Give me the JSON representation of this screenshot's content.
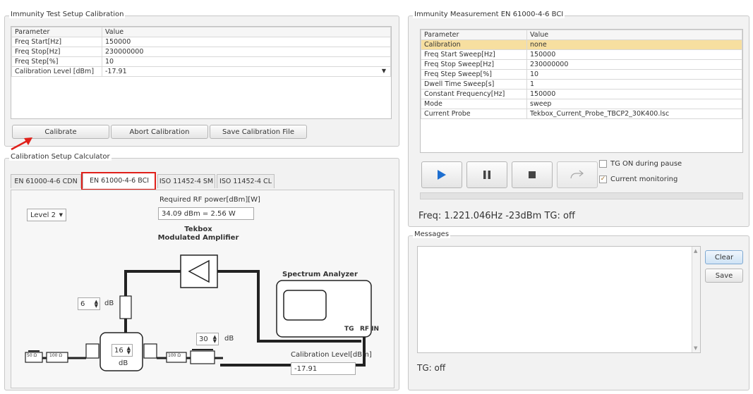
{
  "calibration_group": {
    "title": "Immunity Test Setup Calibration",
    "headers": [
      "Parameter",
      "Value"
    ],
    "rows": [
      [
        "Freq Start[Hz]",
        "150000"
      ],
      [
        "Freq Stop[Hz]",
        "230000000"
      ],
      [
        "Freq Step[%]",
        "10"
      ],
      [
        "Calibration Level [dBm]",
        "-17.91"
      ]
    ],
    "buttons": {
      "calibrate": "Calibrate",
      "abort": "Abort Calibration",
      "save": "Save Calibration File"
    }
  },
  "calculator_group": {
    "title": "Calibration Setup Calculator",
    "tabs": [
      "EN 61000-4-6 CDN",
      "EN 61000-4-6 BCI",
      "ISO 11452-4 SM",
      "ISO 11452-4 CL"
    ],
    "active_tab_index": 1,
    "level_select": "Level 2",
    "required_rf_label": "Required RF power[dBm][W]",
    "required_rf_value": "34.09 dBm = 2.56 W",
    "amplifier_label_1": "Tekbox",
    "amplifier_label_2": "Modulated Amplifier",
    "spectrum_analyzer_label": "Spectrum Analyzer",
    "tg_label": "TG",
    "rfin_label": "RF IN",
    "attenuator_1_value": "6",
    "attenuator_2_value": "30",
    "attenuator_3_value": "16",
    "db_unit": "dB",
    "load_label": "50 Ω",
    "resistor_label": "100 Ω",
    "cal_level_label": "Calibration Level[dBm]",
    "cal_level_value": "-17.91"
  },
  "measurement_group": {
    "title": "Immunity Measurement EN 61000-4-6 BCI",
    "headers": [
      "Parameter",
      "Value"
    ],
    "rows": [
      [
        "Calibration",
        "none"
      ],
      [
        "Freq Start Sweep[Hz]",
        "150000"
      ],
      [
        "Freq Stop Sweep[Hz]",
        "230000000"
      ],
      [
        "Freq Step Sweep[%]",
        "10"
      ],
      [
        "Dwell Time Sweep[s]",
        "1"
      ],
      [
        "Constant Frequency[Hz]",
        "150000"
      ],
      [
        "Mode",
        "sweep"
      ],
      [
        "Current Probe",
        "Tekbox_Current_Probe_TBCP2_30K400.lsc"
      ]
    ],
    "tg_on_pause_label": "TG ON during pause",
    "current_monitoring_label": "Current monitoring",
    "freq_status": "Freq: 1.221.046Hz -23dBm TG: off",
    "highlight_color": "#f7dfa0",
    "play_color": "#1e6fd0"
  },
  "messages_group": {
    "title": "Messages",
    "clear_label": "Clear",
    "save_label": "Save",
    "tg_status": "TG: off"
  },
  "annotation_color": "#e0201a"
}
